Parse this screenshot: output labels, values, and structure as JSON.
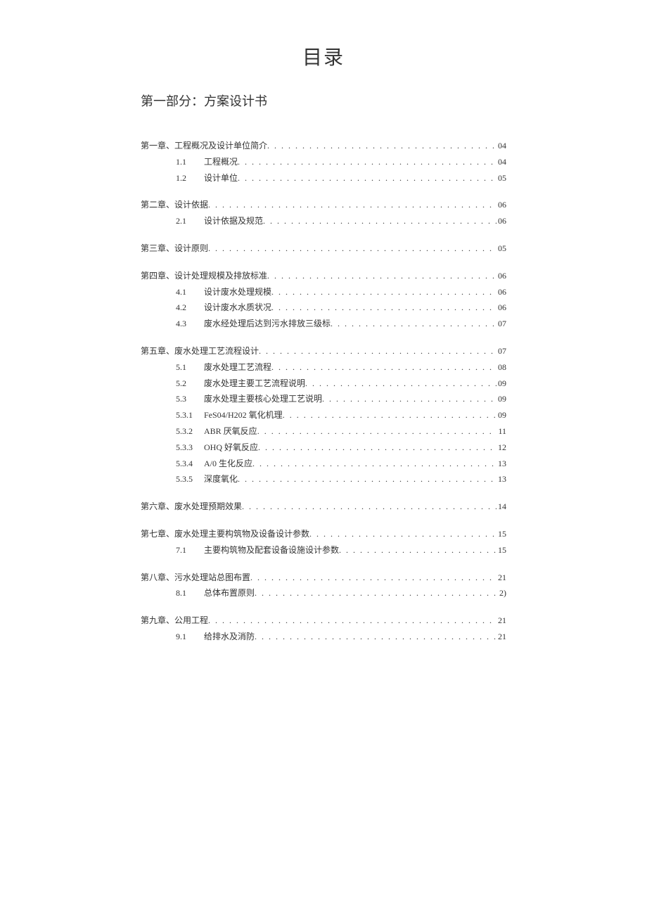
{
  "title": "目录",
  "partTitle": "第一部分：方案设计书",
  "toc": [
    {
      "type": "chapter",
      "label": "第一章、工程概况及设计单位简介",
      "page": "04"
    },
    {
      "type": "sub",
      "num": "1.1",
      "label": "工程概况",
      "page": "04"
    },
    {
      "type": "sub",
      "num": "1.2",
      "label": "设计单位",
      "page": "05"
    },
    {
      "type": "chapter",
      "label": "第二章、设计依据",
      "page": "06"
    },
    {
      "type": "sub",
      "num": "2.1",
      "label": "设计依据及规范",
      "page": "06"
    },
    {
      "type": "chapter",
      "label": "第三章、设计原则",
      "page": "05"
    },
    {
      "type": "chapter",
      "label": "第四章、设计处理规模及排放标准",
      "page": "06"
    },
    {
      "type": "sub",
      "num": "4.1",
      "label": "设计废水处理规模",
      "page": "06"
    },
    {
      "type": "sub",
      "num": "4.2",
      "label": "设计废水水质状况",
      "page": "06",
      "gapBefore": "small"
    },
    {
      "type": "sub",
      "num": "4.3",
      "label": "废水经处理后达到污水排放三级标",
      "page": "07"
    },
    {
      "type": "chapter",
      "label": "第五章、废水处理工艺流程设计",
      "page": "07"
    },
    {
      "type": "sub",
      "num": "5.1",
      "label": "废水处理工艺流程",
      "page": "08"
    },
    {
      "type": "sub",
      "num": "5.2",
      "label": "废水处理主要工艺流程说明",
      "page": "09"
    },
    {
      "type": "sub",
      "num": "5.3",
      "label": "废水处理主要核心处理工艺说明",
      "page": "09"
    },
    {
      "type": "sub",
      "num": "5.3.1",
      "label": "FeS04/H202 氧化机理",
      "page": "09"
    },
    {
      "type": "sub",
      "num": "5.3.2",
      "label": "ABR 厌氧反应",
      "page": "11"
    },
    {
      "type": "sub",
      "num": "5.3.3",
      "label": "OHQ 好氧反应",
      "page": "12"
    },
    {
      "type": "sub",
      "num": "5.3.4",
      "label": "A/0 生化反应",
      "page": "13"
    },
    {
      "type": "sub",
      "num": "5.3.5",
      "label": "深度氧化",
      "page": "13"
    },
    {
      "type": "chapter",
      "label": "第六章、废水处理预期效果",
      "page": "14",
      "extraGap": true
    },
    {
      "type": "chapter",
      "label": "第七章、废水处理主要构筑物及设备设计参数",
      "page": "15"
    },
    {
      "type": "sub",
      "num": "7.1",
      "label": "主要构筑物及配套设备设施设计参数",
      "page": "15"
    },
    {
      "type": "chapter",
      "label": "第八章、污水处理站总图布置",
      "page": "21"
    },
    {
      "type": "sub",
      "num": "8.1",
      "label": "总体布置原则",
      "page": "2)"
    },
    {
      "type": "chapter",
      "label": "第九章、公用工程",
      "page": "21"
    },
    {
      "type": "sub",
      "num": "9.1",
      "label": "给排水及消防",
      "page": "21"
    }
  ]
}
